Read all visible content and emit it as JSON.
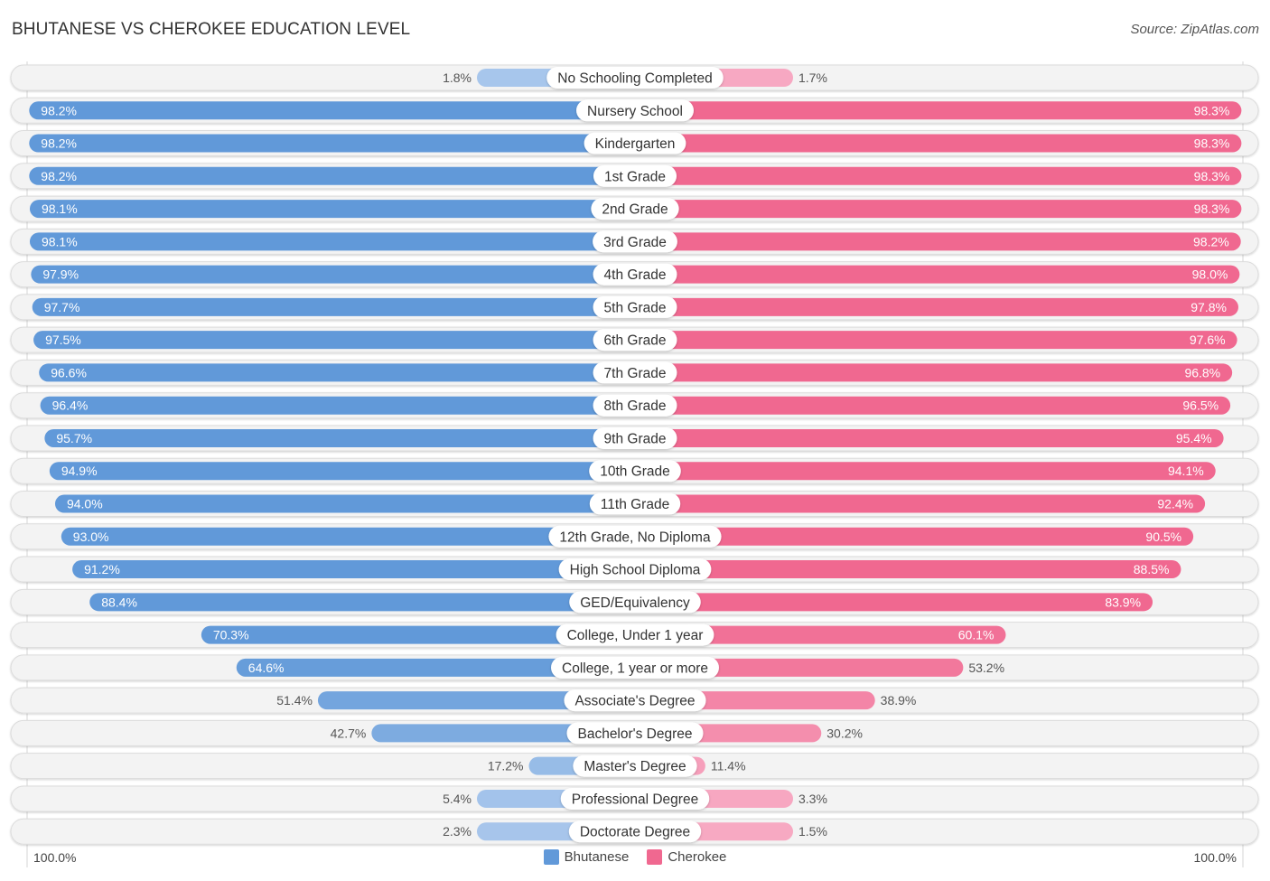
{
  "header": {
    "title": "BHUTANESE VS CHEROKEE EDUCATION LEVEL",
    "source": "Source: ZipAtlas.com"
  },
  "colors": {
    "bhutanese": "#6199d9",
    "bhutanese_light": "#a9c7ec",
    "cherokee": "#f06890",
    "cherokee_light": "#f7aac3",
    "row_bg": "#f3f3f3",
    "row_border": "#dcdcdc"
  },
  "axis": {
    "left_label": "100.0%",
    "right_label": "100.0%"
  },
  "legend": [
    {
      "name": "Bhutanese",
      "color": "#6199d9"
    },
    {
      "name": "Cherokee",
      "color": "#f06890"
    }
  ],
  "chart_data": {
    "type": "bar",
    "orientation": "horizontal-diverging",
    "title": "BHUTANESE VS CHEROKEE EDUCATION LEVEL",
    "xlabel": "",
    "ylabel": "",
    "xlim": [
      0,
      100
    ],
    "legend_position": "bottom-center",
    "categories": [
      "No Schooling Completed",
      "Nursery School",
      "Kindergarten",
      "1st Grade",
      "2nd Grade",
      "3rd Grade",
      "4th Grade",
      "5th Grade",
      "6th Grade",
      "7th Grade",
      "8th Grade",
      "9th Grade",
      "10th Grade",
      "11th Grade",
      "12th Grade, No Diploma",
      "High School Diploma",
      "GED/Equivalency",
      "College, Under 1 year",
      "College, 1 year or more",
      "Associate's Degree",
      "Bachelor's Degree",
      "Master's Degree",
      "Professional Degree",
      "Doctorate Degree"
    ],
    "series": [
      {
        "name": "Bhutanese",
        "side": "left",
        "values": [
          1.8,
          98.2,
          98.2,
          98.2,
          98.1,
          98.1,
          97.9,
          97.7,
          97.5,
          96.6,
          96.4,
          95.7,
          94.9,
          94.0,
          93.0,
          91.2,
          88.4,
          70.3,
          64.6,
          51.4,
          42.7,
          17.2,
          5.4,
          2.3
        ],
        "labels": [
          "1.8%",
          "98.2%",
          "98.2%",
          "98.2%",
          "98.1%",
          "98.1%",
          "97.9%",
          "97.7%",
          "97.5%",
          "96.6%",
          "96.4%",
          "95.7%",
          "94.9%",
          "94.0%",
          "93.0%",
          "91.2%",
          "88.4%",
          "70.3%",
          "64.6%",
          "51.4%",
          "42.7%",
          "17.2%",
          "5.4%",
          "2.3%"
        ]
      },
      {
        "name": "Cherokee",
        "side": "right",
        "values": [
          1.7,
          98.3,
          98.3,
          98.3,
          98.3,
          98.2,
          98.0,
          97.8,
          97.6,
          96.8,
          96.5,
          95.4,
          94.1,
          92.4,
          90.5,
          88.5,
          83.9,
          60.1,
          53.2,
          38.9,
          30.2,
          11.4,
          3.3,
          1.5
        ],
        "labels": [
          "1.7%",
          "98.3%",
          "98.3%",
          "98.3%",
          "98.3%",
          "98.2%",
          "98.0%",
          "97.8%",
          "97.6%",
          "96.8%",
          "96.5%",
          "95.4%",
          "94.1%",
          "92.4%",
          "90.5%",
          "88.5%",
          "83.9%",
          "60.1%",
          "53.2%",
          "38.9%",
          "30.2%",
          "11.4%",
          "3.3%",
          "1.5%"
        ]
      }
    ]
  }
}
